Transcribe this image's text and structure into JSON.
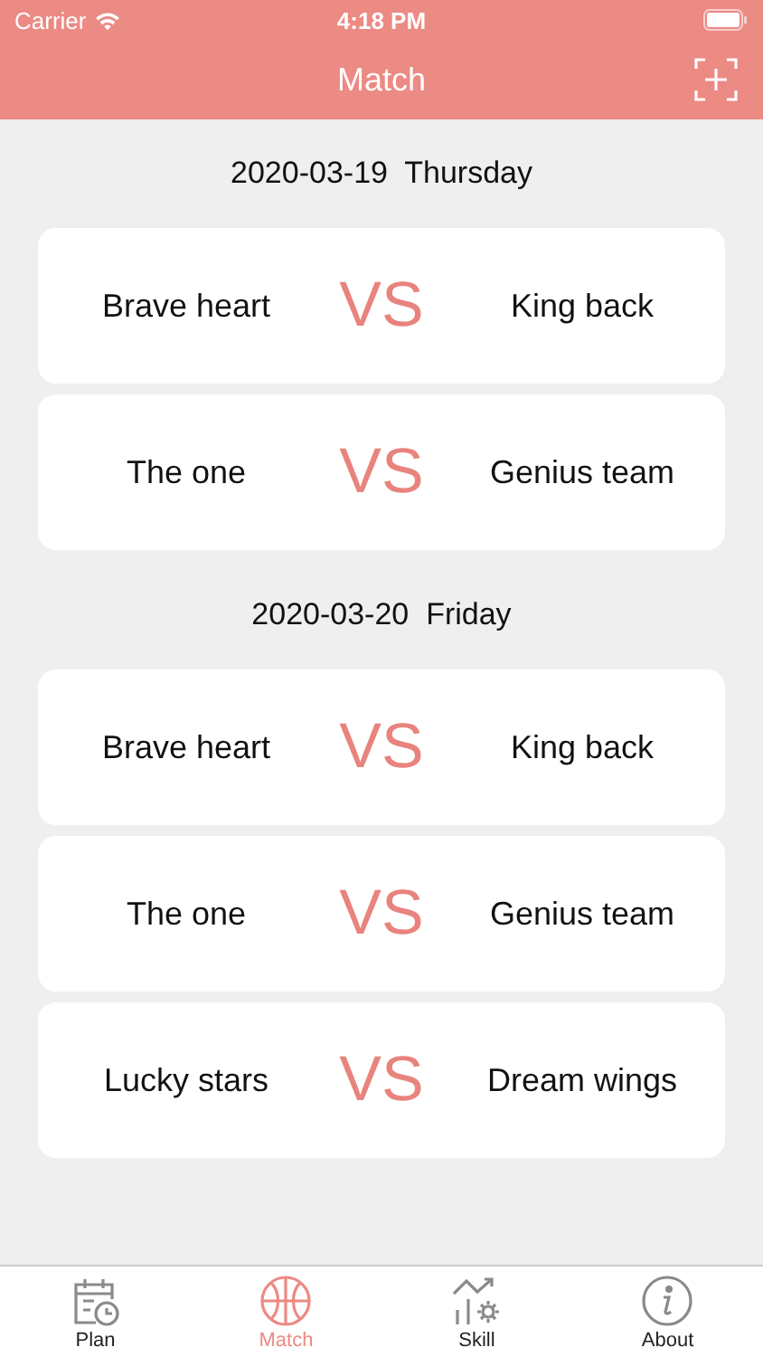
{
  "status_bar": {
    "carrier": "Carrier",
    "time": "4:18 PM"
  },
  "nav": {
    "title": "Match"
  },
  "days": [
    {
      "date": "2020-03-19  Thursday",
      "matches": [
        {
          "home": "Brave heart",
          "vs": "VS",
          "away": "King back"
        },
        {
          "home": "The one",
          "vs": "VS",
          "away": "Genius team"
        }
      ]
    },
    {
      "date": "2020-03-20  Friday",
      "matches": [
        {
          "home": "Brave heart",
          "vs": "VS",
          "away": "King back"
        },
        {
          "home": "The one",
          "vs": "VS",
          "away": "Genius team"
        },
        {
          "home": "Lucky stars",
          "vs": "VS",
          "away": "Dream wings"
        }
      ]
    }
  ],
  "tabs": [
    {
      "label": "Plan",
      "kind": "plan",
      "selected": false
    },
    {
      "label": "Match",
      "kind": "match",
      "selected": true
    },
    {
      "label": "Skill",
      "kind": "skill",
      "selected": false
    },
    {
      "label": "About",
      "kind": "about",
      "selected": false
    }
  ]
}
